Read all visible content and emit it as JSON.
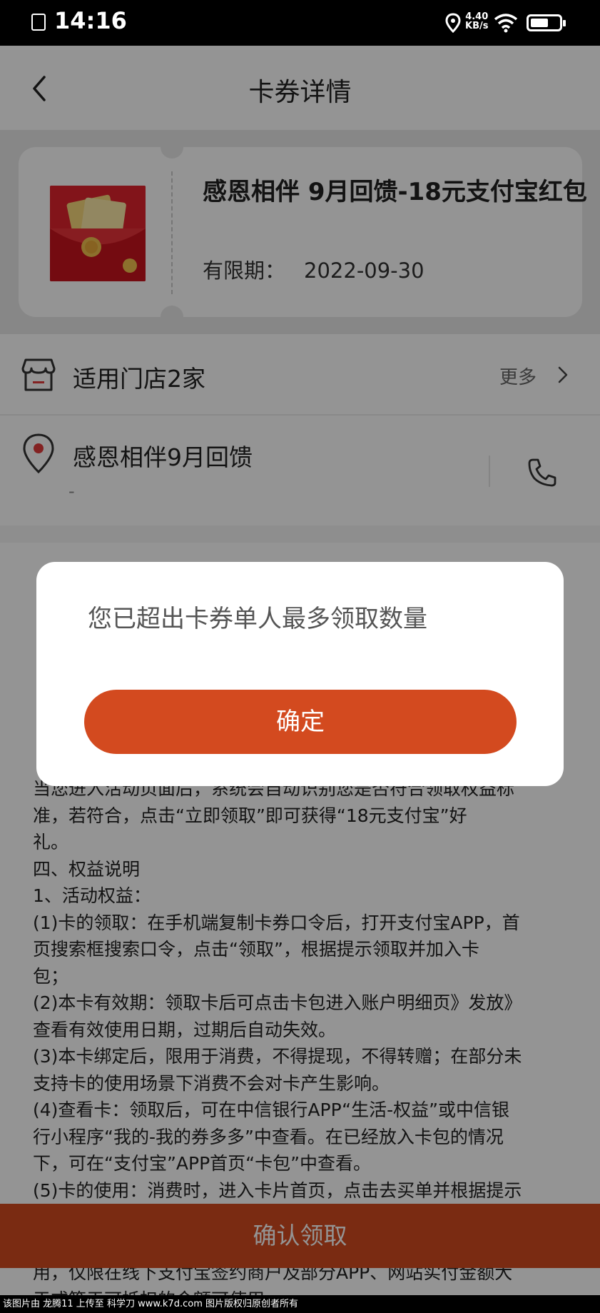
{
  "status_bar": {
    "time": "14:16",
    "net_speed_value": "4.40",
    "net_speed_unit": "KB/s"
  },
  "header": {
    "title": "卡券详情"
  },
  "coupon": {
    "title": "感恩相伴 9月回馈-18元支付宝红包",
    "expiry_label": "有限期：",
    "expiry_date": "2022-09-30"
  },
  "stores": {
    "label": "适用门店2家",
    "more": "更多"
  },
  "shop": {
    "name": "感恩相伴9月回馈",
    "address": "-"
  },
  "details": {
    "lines": [
      "当您进入活动页面后，系统会自动识别您是否符合领取权益标",
      "准，若符合，点击“立即领取”即可获得“18元支付宝”好",
      "礼。",
      "四、权益说明",
      "1、活动权益：",
      "(1)卡的领取：在手机端复制卡券口令后，打开支付宝APP，首",
      "页搜索框搜索口令，点击“领取”，根据提示领取并加入卡",
      "包；",
      "(2)本卡有效期：领取卡后可点击卡包进入账户明细页》发放》",
      "查看有效使用日期，过期后自动失效。",
      "(3)本卡绑定后，限用于消费，不得提现，不得转赠；在部分未",
      "支持卡的使用场景下消费不会对卡产生影响。",
      "(4)查看卡：领取后，可在中信银行APP“生活-权益”或中信银",
      "行小程序“我的-我的券多多”中查看。在已经放入卡包的情况",
      "下，可在“支付宝”APP首页“卡包”中查看。",
      "(5)卡的使用：消费时，进入卡片首页，点击去买单并根据提示",
      "用，仅限在线下支付宝签约商户及部分APP、网站实付金额大",
      "于或等于可抵扣的金额可使用。"
    ]
  },
  "bottom_bar": {
    "button": "确认领取"
  },
  "dialog": {
    "message": "您已超出卡券单人最多领取数量",
    "confirm": "确定"
  },
  "watermark": {
    "text": "该图片由 龙腾11 上传至 科学刀 www.k7d.com 图片版权归原创者所有"
  },
  "colors": {
    "accent": "#d34a1f",
    "coupon_red": "#e0232e",
    "location_red": "#e23b3b"
  }
}
